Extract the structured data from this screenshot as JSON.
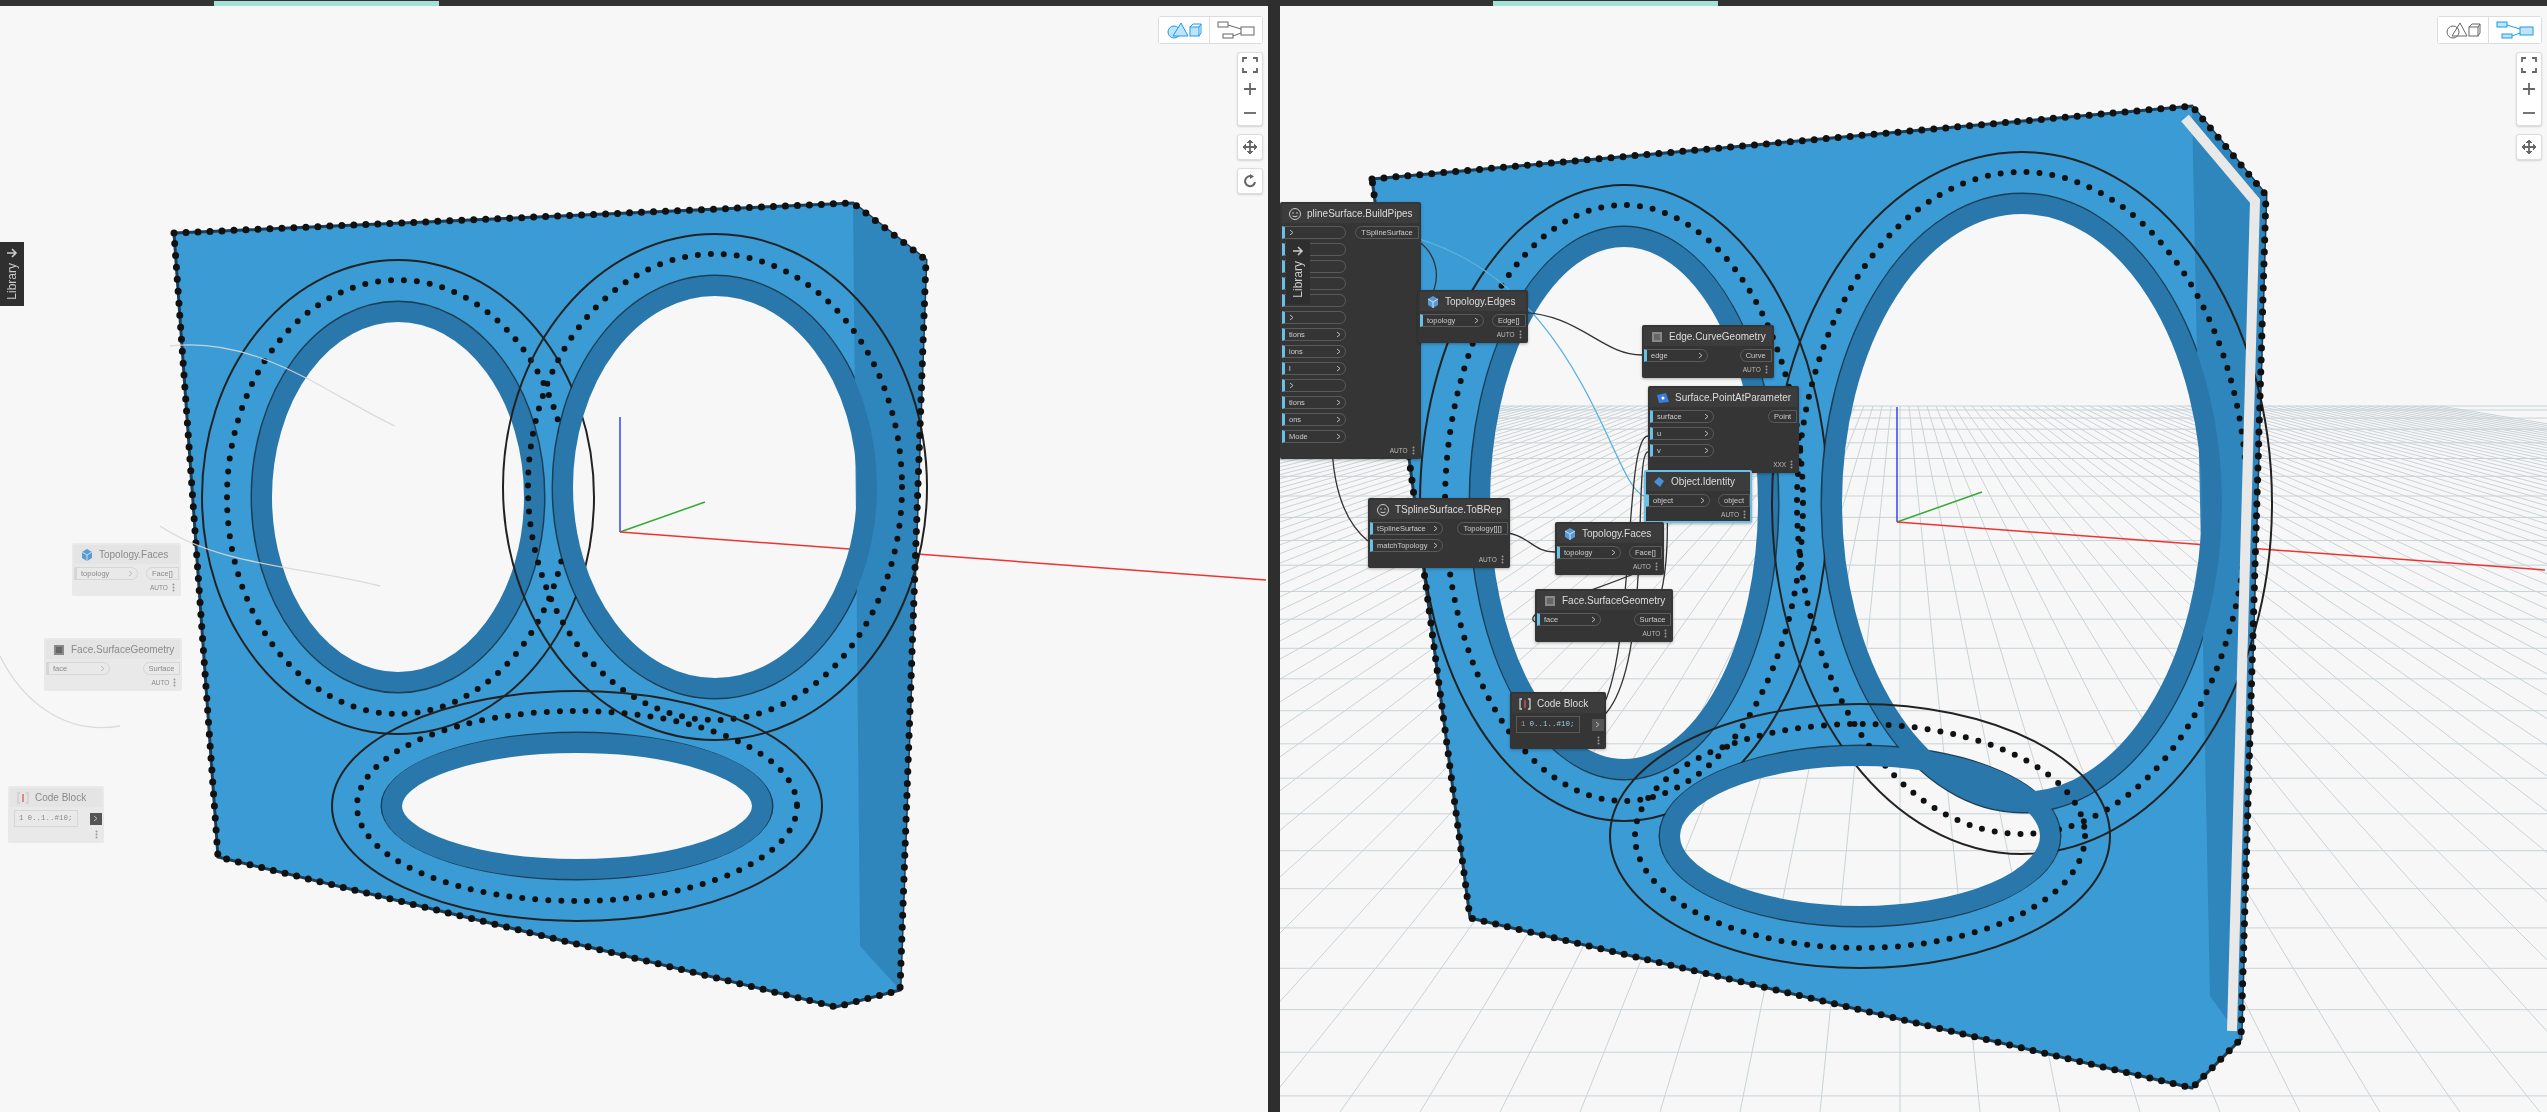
{
  "panels": [
    {
      "view_toggle": [
        {
          "kind": "geometry",
          "selected": true
        },
        {
          "kind": "graph",
          "selected": false
        }
      ],
      "nav_buttons": [
        {
          "kind": "fit"
        },
        {
          "kind": "zoom_in"
        },
        {
          "kind": "zoom_out"
        },
        {
          "kind": "pan"
        },
        {
          "kind": "orbit"
        }
      ],
      "library_tab": {
        "label": "Library"
      },
      "nodes": [
        {
          "kind": "topology",
          "title": "Topology.Faces",
          "inputs": [
            {
              "label": "topology"
            }
          ],
          "outputs": [
            {
              "label": "Face[]"
            }
          ],
          "footer": "AUTO",
          "selected": false
        },
        {
          "kind": "geometry",
          "title": "Face.SurfaceGeometry",
          "inputs": [
            {
              "label": "face"
            }
          ],
          "outputs": [
            {
              "label": "Surface"
            }
          ],
          "footer": "AUTO",
          "selected": false
        },
        {
          "kind": "code_block",
          "title": "Code Block",
          "code_lines": [
            {
              "number": "1",
              "code": "0..1..#10;"
            }
          ],
          "selected": false
        }
      ]
    },
    {
      "view_toggle": [
        {
          "kind": "geometry",
          "selected": false
        },
        {
          "kind": "graph",
          "selected": true
        }
      ],
      "nav_buttons": [
        {
          "kind": "fit"
        },
        {
          "kind": "zoom_in"
        },
        {
          "kind": "zoom_out"
        },
        {
          "kind": "pan"
        }
      ],
      "library_tab": {
        "label": "Library"
      },
      "grid_floor": true,
      "nodes": [
        {
          "kind": "tspline",
          "title": "plineSurface.BuildPipes",
          "inputs": [
            {
              "kind": "blank"
            },
            {
              "kind": "blank"
            },
            {
              "kind": "blank"
            },
            {
              "kind": "blank"
            },
            {
              "kind": "blank"
            },
            {
              "kind": "blank"
            },
            {
              "kind": "labeled",
              "label": "tions"
            },
            {
              "kind": "labeled",
              "label": "ions"
            },
            {
              "kind": "labeled",
              "label": "l"
            },
            {
              "kind": "blank"
            },
            {
              "kind": "labeled",
              "label": "tions"
            },
            {
              "kind": "labeled",
              "label": "ons"
            },
            {
              "kind": "labeled",
              "label": "Mode"
            }
          ],
          "outputs": [
            {
              "label": "TSplineSurface"
            }
          ],
          "footer": "AUTO",
          "selected": false
        },
        {
          "kind": "topology",
          "title": "Topology.Edges",
          "inputs": [
            {
              "label": "topology"
            }
          ],
          "outputs": [
            {
              "label": "Edge[]"
            }
          ],
          "footer": "AUTO",
          "selected": false
        },
        {
          "kind": "geometry",
          "title": "Edge.CurveGeometry",
          "inputs": [
            {
              "label": "edge"
            }
          ],
          "outputs": [
            {
              "label": "Curve"
            }
          ],
          "footer": "AUTO",
          "selected": false
        },
        {
          "kind": "surface",
          "title": "Surface.PointAtParameter",
          "inputs": [
            {
              "label": "surface"
            },
            {
              "label": "u"
            },
            {
              "label": "v"
            }
          ],
          "outputs": [
            {
              "label": "Point"
            }
          ],
          "footer": "XXX",
          "selected": false
        },
        {
          "kind": "object",
          "title": "Object.Identity",
          "inputs": [
            {
              "label": "object"
            }
          ],
          "outputs": [
            {
              "label": "object"
            }
          ],
          "footer": "AUTO",
          "selected": true
        },
        {
          "kind": "tspline",
          "title": "TSplineSurface.ToBRep",
          "inputs": [
            {
              "label": "tSplineSurface"
            },
            {
              "label": "matchTopology"
            }
          ],
          "outputs": [
            {
              "label": "Topology[][]"
            }
          ],
          "footer": "AUTO",
          "selected": false
        },
        {
          "kind": "topology",
          "title": "Topology.Faces",
          "inputs": [
            {
              "label": "topology"
            }
          ],
          "outputs": [
            {
              "label": "Face[]"
            }
          ],
          "footer": "AUTO",
          "selected": false
        },
        {
          "kind": "geometry",
          "title": "Face.SurfaceGeometry",
          "inputs": [
            {
              "label": "face"
            }
          ],
          "outputs": [
            {
              "label": "Surface"
            }
          ],
          "footer": "AUTO",
          "selected": false
        },
        {
          "kind": "code_block",
          "title": "Code Block",
          "code_lines": [
            {
              "number": "1",
              "code": "0..1..#10;"
            }
          ],
          "selected": false
        }
      ]
    }
  ]
}
